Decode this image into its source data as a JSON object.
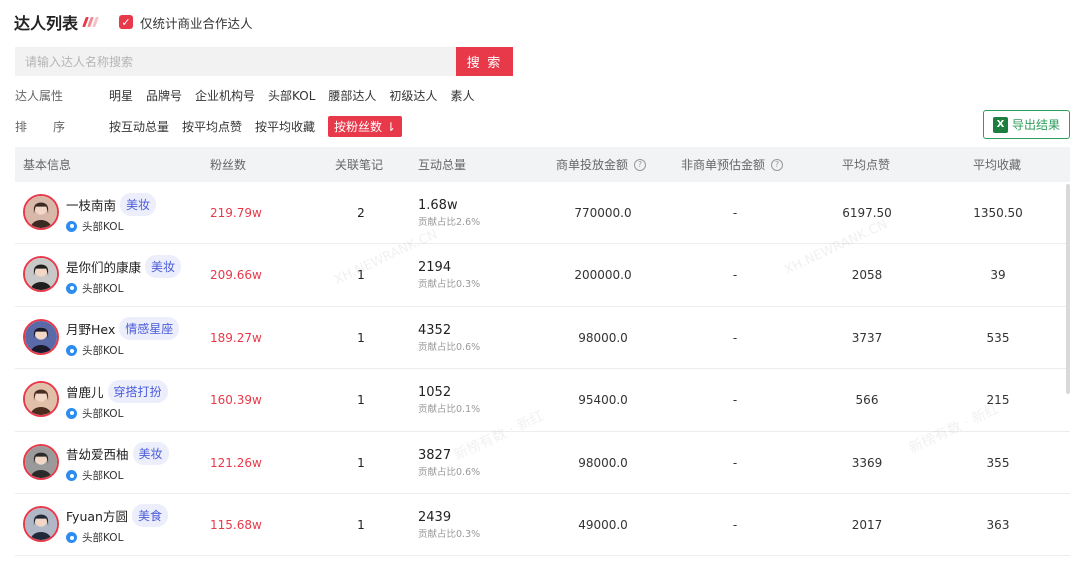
{
  "header": {
    "title": "达人列表",
    "checkbox_label": "仅统计商业合作达人",
    "checkbox_checked": true
  },
  "search": {
    "placeholder": "请输入达人名称搜索",
    "value": "",
    "button_label": "搜 索"
  },
  "filters": {
    "attr_label": "达人属性",
    "attr_options": [
      "明星",
      "品牌号",
      "企业机构号",
      "头部KOL",
      "腰部达人",
      "初级达人",
      "素人"
    ],
    "sort_label_a": "排",
    "sort_label_b": "序",
    "sort_options": [
      "按互动总量",
      "按平均点赞",
      "按平均收藏"
    ],
    "sort_active": "按粉丝数 ⇂"
  },
  "export_button": "导出结果",
  "columns": [
    "基本信息",
    "粉丝数",
    "关联笔记",
    "互动总量",
    "商单投放金额",
    "非商单预估金额",
    "平均点赞",
    "平均收藏"
  ],
  "accent_color": "#e8394a",
  "rows": [
    {
      "name": "一枝南南",
      "tag": "美妆",
      "level": "头部KOL",
      "fans": "219.79w",
      "notes": "2",
      "interact": "1.68w",
      "share": "贡献占比2.6%",
      "paid": "770000.0",
      "unpaid": "-",
      "avg_like": "6197.50",
      "avg_fav": "1350.50"
    },
    {
      "name": "是你们的康康",
      "tag": "美妆",
      "level": "头部KOL",
      "fans": "209.66w",
      "notes": "1",
      "interact": "2194",
      "share": "贡献占比0.3%",
      "paid": "200000.0",
      "unpaid": "-",
      "avg_like": "2058",
      "avg_fav": "39"
    },
    {
      "name": "月野Hex",
      "tag": "情感星座",
      "level": "头部KOL",
      "fans": "189.27w",
      "notes": "1",
      "interact": "4352",
      "share": "贡献占比0.6%",
      "paid": "98000.0",
      "unpaid": "-",
      "avg_like": "3737",
      "avg_fav": "535"
    },
    {
      "name": "曾鹿儿",
      "tag": "穿搭打扮",
      "level": "头部KOL",
      "fans": "160.39w",
      "notes": "1",
      "interact": "1052",
      "share": "贡献占比0.1%",
      "paid": "95400.0",
      "unpaid": "-",
      "avg_like": "566",
      "avg_fav": "215"
    },
    {
      "name": "昔幼爱西柚",
      "tag": "美妆",
      "level": "头部KOL",
      "fans": "121.26w",
      "notes": "1",
      "interact": "3827",
      "share": "贡献占比0.6%",
      "paid": "98000.0",
      "unpaid": "-",
      "avg_like": "3369",
      "avg_fav": "355"
    },
    {
      "name": "Fyuan方圆",
      "tag": "美食",
      "level": "头部KOL",
      "fans": "115.68w",
      "notes": "1",
      "interact": "2439",
      "share": "贡献占比0.3%",
      "paid": "49000.0",
      "unpaid": "-",
      "avg_like": "2017",
      "avg_fav": "363"
    }
  ],
  "watermarks": [
    "XH.NEWRANK.CN",
    "新榜有数 · 新红"
  ]
}
